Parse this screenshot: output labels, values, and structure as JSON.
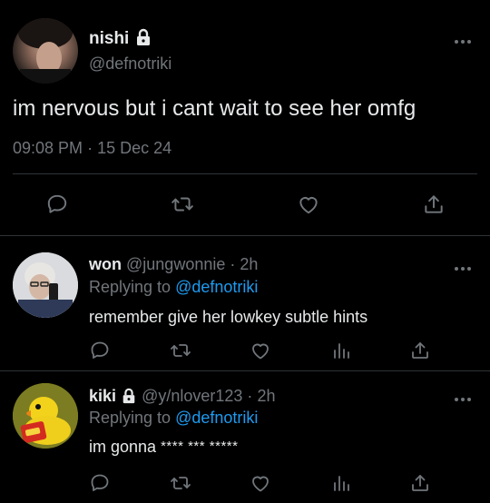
{
  "main_tweet": {
    "display_name": "nishi",
    "handle": "@defnotriki",
    "text": "im nervous but i cant wait to see her omfg",
    "time": "09:08 PM",
    "date": "15 Dec 24",
    "separator": "·"
  },
  "replies": [
    {
      "display_name": "won",
      "handle": "@jungwonnie",
      "age": "2h",
      "replying_prefix": "Replying to",
      "replying_handle": "@defnotriki",
      "text": "remember give her lowkey subtle hints"
    },
    {
      "display_name": "kiki",
      "handle": "@y/nlover123",
      "age": "2h",
      "replying_prefix": "Replying to",
      "replying_handle": "@defnotriki",
      "text": "im gonna",
      "censored": "**** *** *****"
    }
  ],
  "icons": {
    "more": "more-horizontal-icon",
    "reply": "reply-bubble-icon",
    "retweet": "retweet-icon",
    "like": "heart-icon",
    "views": "views-bar-icon",
    "share": "share-upload-icon",
    "lock": "lock-icon"
  },
  "colors": {
    "background": "#000000",
    "text": "#e7e9ea",
    "secondary": "#71767b",
    "accent": "#1d9bf0",
    "divider": "#2f3336"
  }
}
